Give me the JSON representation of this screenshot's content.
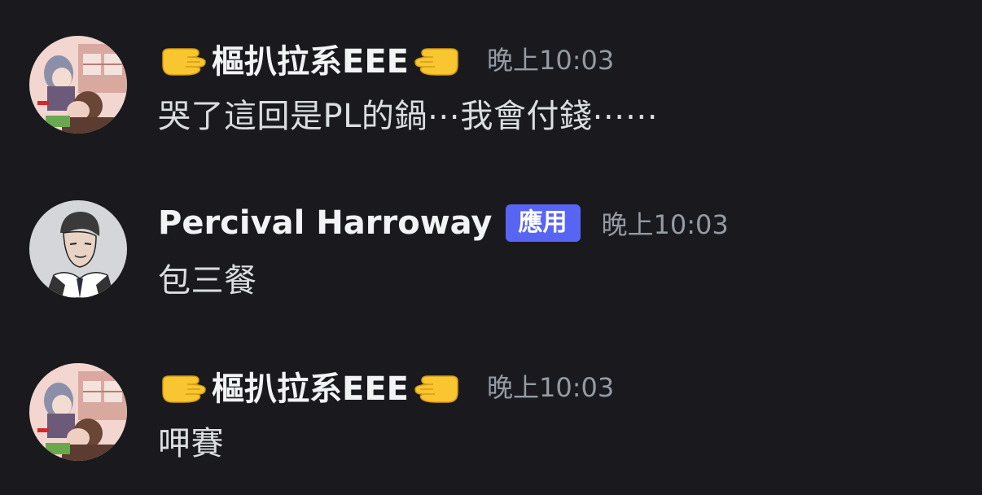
{
  "messages": [
    {
      "author": "樞扒拉系EEE",
      "author_prefix_icon": "hand-pointing-right-icon",
      "author_suffix_icon": "hand-pointing-left-icon",
      "timestamp": "晚上10:03",
      "content": "哭了這回是PL的鍋⋯我會付錢⋯⋯",
      "avatar": "anime-character-avatar"
    },
    {
      "author": "Percival Harroway",
      "badge": "應用",
      "timestamp": "晚上10:03",
      "content": "包三餐",
      "avatar": "suited-man-sketch-avatar"
    },
    {
      "author": "樞扒拉系EEE",
      "author_prefix_icon": "hand-pointing-right-icon",
      "author_suffix_icon": "hand-pointing-left-icon",
      "timestamp": "晚上10:03",
      "content": "呷賽",
      "avatar": "anime-character-avatar"
    }
  ],
  "colors": {
    "background": "#1a1a1e",
    "username": "#f2f3f5",
    "message_text": "#dbdee1",
    "timestamp": "#949ba4",
    "app_badge": "#5865f2"
  }
}
